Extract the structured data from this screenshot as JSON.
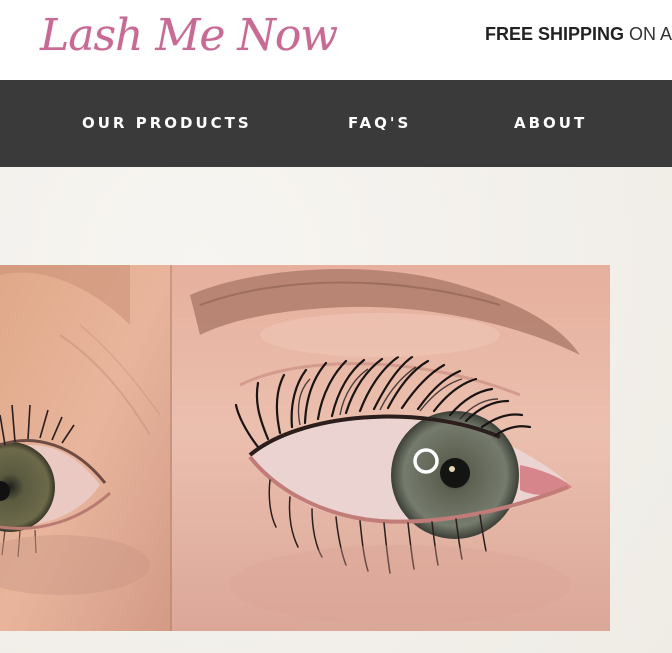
{
  "header": {
    "logo_text": "Lash Me Now",
    "shipping_bold": "FREE SHIPPING",
    "shipping_rest": " ON AL"
  },
  "nav": {
    "items": [
      {
        "label": "OUR PRODUCTS"
      },
      {
        "label": "FAQ'S"
      },
      {
        "label": "ABOUT"
      }
    ]
  },
  "colors": {
    "brand_pink": "#c86b94",
    "nav_bg": "#3a3a3a",
    "page_bg": "#f3f1ec"
  },
  "hero": {
    "image_desc_icon": "before-after-lash-photo"
  }
}
